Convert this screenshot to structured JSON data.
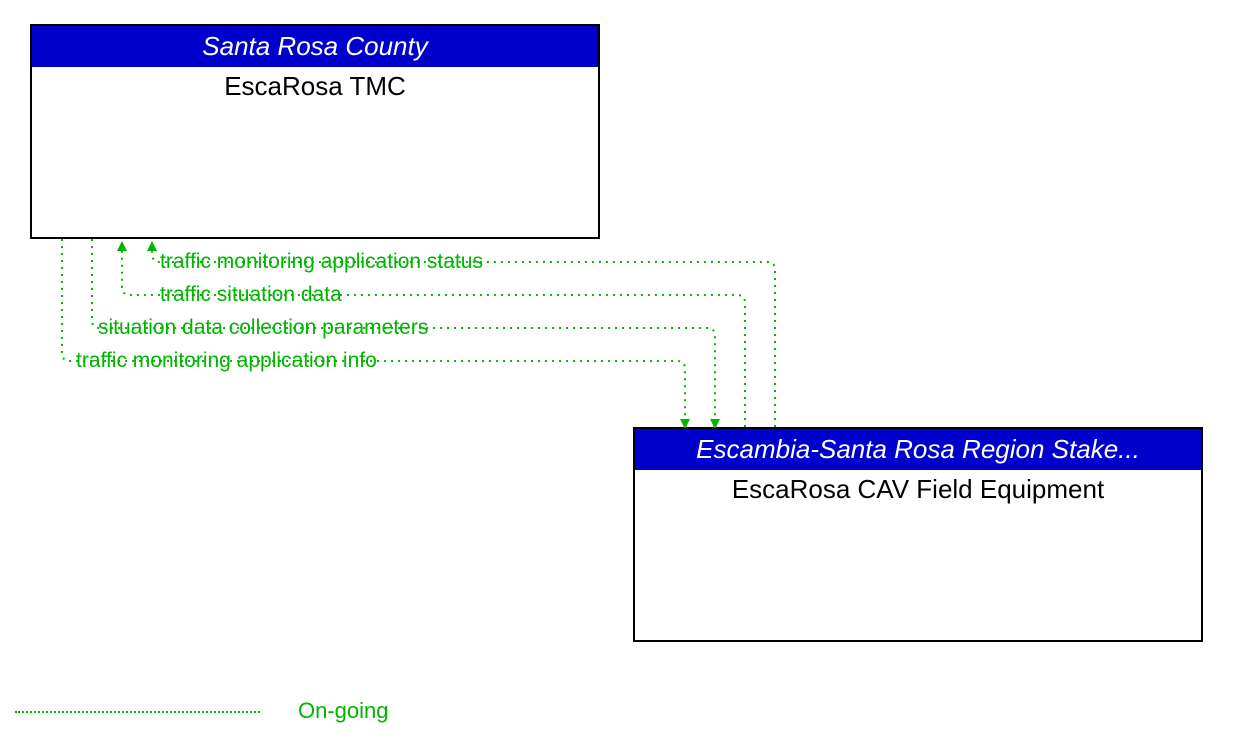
{
  "nodes": {
    "top": {
      "header": "Santa Rosa County",
      "title": "EscaRosa TMC"
    },
    "bottom": {
      "header": "Escambia-Santa Rosa Region Stake...",
      "title": "EscaRosa CAV Field Equipment"
    }
  },
  "flows": {
    "f1": "traffic monitoring application status",
    "f2": "traffic situation data",
    "f3": "situation data collection parameters",
    "f4": "traffic monitoring application info"
  },
  "legend": {
    "ongoing": "On-going"
  }
}
